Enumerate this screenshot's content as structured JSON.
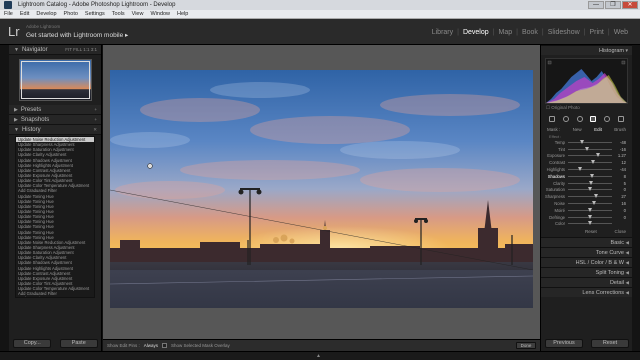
{
  "window": {
    "title": "Lightroom Catalog - Adobe Photoshop Lightroom - Develop",
    "buttons": [
      "—",
      "❐",
      "✕"
    ]
  },
  "menu": [
    "File",
    "Edit",
    "Develop",
    "Photo",
    "Settings",
    "Tools",
    "View",
    "Window",
    "Help"
  ],
  "identity": {
    "logo": "Lr",
    "sub": "Adobe Lightroom",
    "main": "Get started with Lightroom mobile ▸"
  },
  "modules": [
    "Library",
    "Develop",
    "Map",
    "Book",
    "Slideshow",
    "Print",
    "Web"
  ],
  "active_module": "Develop",
  "left": {
    "navigator": {
      "label": "Navigator",
      "zoom": "FIT  FILL  1:1  3:1"
    },
    "presets": "Presets",
    "snapshots": "Snapshots",
    "history": "History",
    "history_items": [
      "Update Noise Reduction Adjustment",
      "Update Sharpness Adjustment",
      "Update Saturation Adjustment",
      "Update Clarity Adjustment",
      "Update Shadows Adjustment",
      "Update Highlights Adjustment",
      "Update Contrast Adjustment",
      "Update Exposure Adjustment",
      "Update Color Tint Adjustment",
      "Update Color Temperature Adjustment",
      "Add Graduated Filter",
      "Update Toning Hue",
      "Update Toning Hue",
      "Update Toning Hue",
      "Update Toning Hue",
      "Update Toning Hue",
      "Update Toning Hue",
      "Update Toning Hue",
      "Update Toning Hue",
      "Update Toning Hue",
      "Update Noise Reduction Adjustment",
      "Update Sharpness Adjustment",
      "Update Saturation Adjustment",
      "Update Clarity Adjustment",
      "Update Shadows Adjustment",
      "Update Highlights Adjustment",
      "Update Contrast Adjustment",
      "Update Exposure Adjustment",
      "Update Color Tint Adjustment",
      "Update Color Temperature Adjustment",
      "Add Graduated Filter",
      "Update Toning Hue"
    ],
    "selected_history_index": 0,
    "copy": "Copy...",
    "paste": "Paste"
  },
  "toolbar": {
    "show_edit_pins": "Show Edit Pins :",
    "pins_value": "Always",
    "show_overlay": "Show Selected Mask Overlay",
    "done": "Done"
  },
  "right": {
    "histogram": "Histogram",
    "original_photo": "Original Photo",
    "mask_row": {
      "mask": "Mask :",
      "new": "New",
      "edit": "Edit",
      "brush": "Brush"
    },
    "effect": "Effect :",
    "sliders": [
      {
        "label": "Temp",
        "value": "-48",
        "pos": 0.32
      },
      {
        "label": "Tint",
        "value": "-16",
        "pos": 0.44
      },
      {
        "label": "Exposure",
        "value": "1.27",
        "pos": 0.68
      },
      {
        "label": "Contrast",
        "value": "12",
        "pos": 0.56
      },
      {
        "label": "Highlights",
        "value": "-44",
        "pos": 0.28
      },
      {
        "label": "Shadows",
        "value": "8",
        "pos": 0.54,
        "hot": true
      },
      {
        "label": "Clarity",
        "value": "5",
        "pos": 0.52
      },
      {
        "label": "Saturation",
        "value": "0",
        "pos": 0.5
      },
      {
        "label": "Sharpness",
        "value": "27",
        "pos": 0.63
      },
      {
        "label": "Noise",
        "value": "16",
        "pos": 0.58
      },
      {
        "label": "Moiré",
        "value": "0",
        "pos": 0.5
      },
      {
        "label": "Defringe",
        "value": "0",
        "pos": 0.5
      },
      {
        "label": "Color",
        "value": "",
        "pos": 0.5
      }
    ],
    "reset_close": {
      "reset": "Reset",
      "close": "Close"
    },
    "sections": [
      "Basic",
      "Tone Curve",
      "HSL  /  Color  /  B & W",
      "Split Toning",
      "Detail",
      "Lens Corrections"
    ],
    "previous": "Previous",
    "reset": "Reset"
  }
}
